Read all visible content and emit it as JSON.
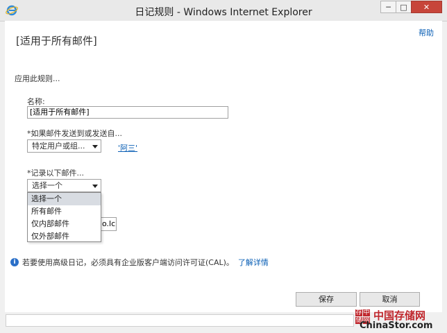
{
  "window": {
    "title": "日记规则 - Windows Internet Explorer",
    "min_symbol": "─",
    "max_symbol": "□",
    "close_symbol": "✕"
  },
  "header": {
    "help": "帮助",
    "page_title": "[适用于所有邮件]"
  },
  "form": {
    "apply_rule": "应用此规则...",
    "name_label": "名称:",
    "name_value": "[适用于所有邮件]",
    "sender_label": "*如果邮件发送到或发送自...",
    "sender_select": "特定用户或组...",
    "sender_link": "'阿三'",
    "record_label": "*记录以下邮件...",
    "record_select": "选择一个",
    "record_options": [
      "选择一个",
      "所有邮件",
      "仅内部邮件",
      "仅外部邮件"
    ],
    "hidden_field_value": "o.lc"
  },
  "info": {
    "icon": "i",
    "text": "若要使用高级日记，必须具有企业版客户端访问许可证(CAL)。",
    "link": "了解详情"
  },
  "buttons": {
    "save": "保存",
    "cancel": "取消"
  },
  "watermark": {
    "chars": [
      "存",
      "中",
      "储",
      "网"
    ],
    "cn": "中国存储网",
    "en": "ChinaStor.com"
  },
  "colors": {
    "link": "#0a5fb5",
    "close": "#c7453a",
    "brand": "#c0272d"
  }
}
